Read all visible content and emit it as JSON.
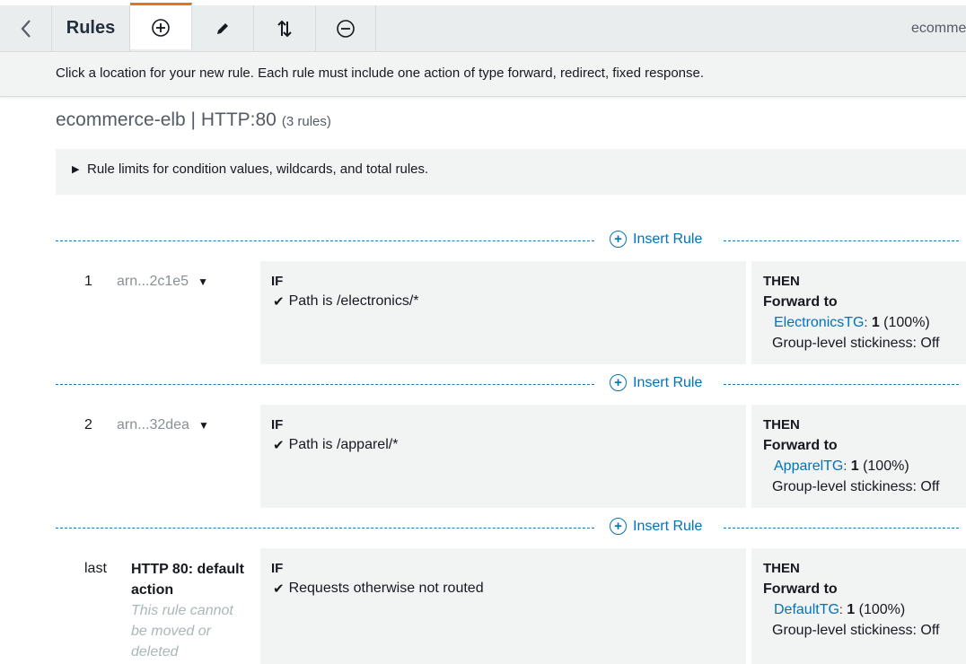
{
  "toolbar": {
    "title": "Rules",
    "right_text": "ecommerce-elb"
  },
  "info": "Click a location for your new rule. Each rule must include one action of type forward, redirect, fixed response.",
  "heading": {
    "name": "ecommerce-elb | HTTP:80",
    "count": "(3 rules)"
  },
  "limits_text": "Rule limits for condition values, wildcards, and total rules.",
  "insert_label": "Insert Rule",
  "labels": {
    "if": "IF",
    "then": "THEN",
    "forward": "Forward to",
    "sep": ":",
    "stickiness": "Group-level stickiness: Off"
  },
  "rules": [
    {
      "num": "1",
      "arn": "arn...2c1e5",
      "condition": "Path is /electronics/*",
      "target": "ElectronicsTG",
      "weight": "1",
      "percent": "(100%)"
    },
    {
      "num": "2",
      "arn": "arn...32dea",
      "condition": "Path is /apparel/*",
      "target": "ApparelTG",
      "weight": "1",
      "percent": "(100%)"
    },
    {
      "num": "last",
      "name": "HTTP 80: default action",
      "note": "This rule cannot be moved or deleted",
      "condition": "Requests otherwise not routed",
      "target": "DefaultTG",
      "weight": "1",
      "percent": "(100%)"
    }
  ],
  "colors": {
    "accent": "#ec7211",
    "link": "#0073bb"
  }
}
